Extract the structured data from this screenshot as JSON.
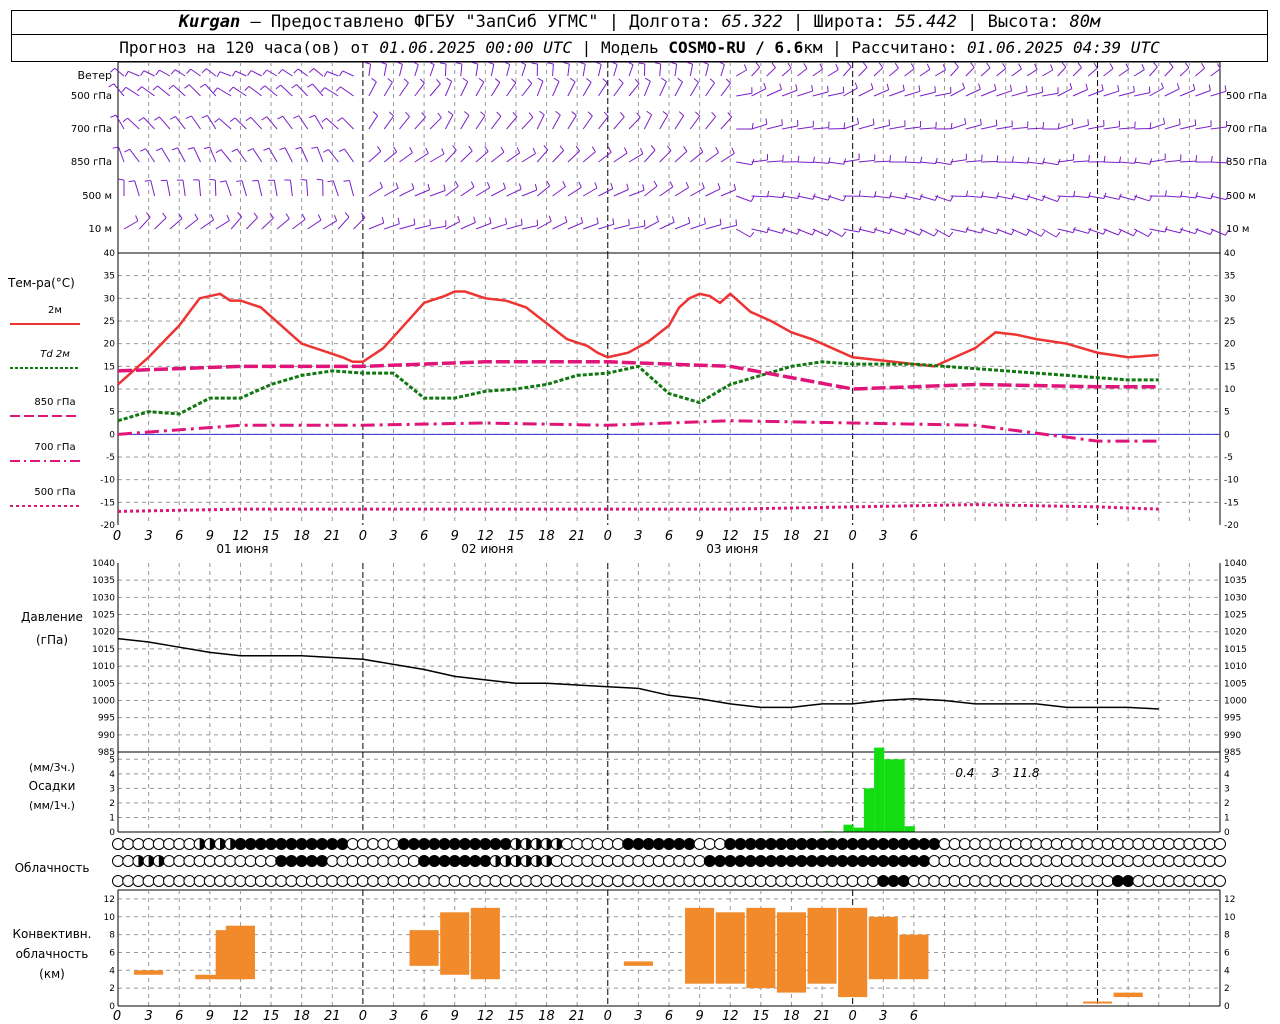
{
  "header": {
    "station": "Kurgan",
    "dash": " — ",
    "provider": "Предоставлено ФГБУ \"ЗапСиб УГМС\"",
    "lon_label": "Долгота:",
    "lon": "65.322",
    "lat_label": "Широта:",
    "lat": "55.442",
    "alt_label": "Высота:",
    "alt": "80м",
    "forecast_prefix": "Прогноз на 120 часа(ов) от",
    "forecast_time": "01.06.2025 00:00 UTC",
    "model_label": "Модель",
    "model": "COSMO-RU / 6.6",
    "model_unit": "км",
    "calc_label": "Рассчитано:",
    "calc_time": "01.06.2025 04:39 UTC",
    "sep": "|"
  },
  "wind": {
    "title": "Ветер",
    "levels": [
      "500 гПа",
      "700 гПа",
      "850 гПа",
      "500  м",
      "10   м"
    ]
  },
  "x_ticks": [
    "0",
    "3",
    "6",
    "9",
    "12",
    "15",
    "18",
    "21",
    "0",
    "3",
    "6",
    "9",
    "12",
    "15",
    "18",
    "21",
    "0",
    "3",
    "6",
    "9",
    "12",
    "15",
    "18",
    "21",
    "0",
    "3",
    "6"
  ],
  "day_labels": [
    "01 июня",
    "02 июня",
    "03 июня"
  ],
  "temperature": {
    "title": "Тем-ра(°C)",
    "legend": [
      {
        "label": "2м",
        "color": "#ee3333",
        "style": "solid"
      },
      {
        "label": "Td  2м",
        "color": "#117711",
        "style": "dotted"
      },
      {
        "label": "850 гПа",
        "color": "#e0157a",
        "style": "dash"
      },
      {
        "label": "700 гПа",
        "color": "#e0157a",
        "style": "dashdot"
      },
      {
        "label": "500 гПа",
        "color": "#e0157a",
        "style": "dot"
      }
    ],
    "y_ticks": [
      "40",
      "35",
      "30",
      "25",
      "20",
      "15",
      "10",
      "5",
      "0",
      "-5",
      "-10",
      "-15",
      "-20"
    ]
  },
  "pressure": {
    "title1": "Давление",
    "title2": "(гПа)",
    "y_ticks": [
      "1040",
      "1035",
      "1030",
      "1025",
      "1020",
      "1015",
      "1010",
      "1005",
      "1000",
      "995",
      "990",
      "985"
    ]
  },
  "precip": {
    "title1": "(мм/3ч.)",
    "title2": "Осадки",
    "title3": "(мм/1ч.)",
    "y_ticks": [
      "5",
      "4",
      "3",
      "2",
      "1",
      "0"
    ],
    "labels": [
      {
        "text": "0.4",
        "h": 83
      },
      {
        "text": "3",
        "h": 86
      },
      {
        "text": "11.8",
        "h": 89
      }
    ]
  },
  "clouds": {
    "title": "Облачность"
  },
  "convective": {
    "title1": "Конвективн.",
    "title2": "облачность",
    "title3": "(км)",
    "y_ticks": [
      "12",
      "10",
      "8",
      "6",
      "4",
      "2",
      "0"
    ]
  },
  "colors": {
    "temp2m": "#ee3333",
    "td": "#117711",
    "upper": "#e0157a",
    "wind": "#7a1fc9",
    "precip": "#11dd11",
    "conv": "#f08a2a",
    "grid": "#999999"
  },
  "chart_data": [
    {
      "type": "line",
      "title": "Тем-ра(°C)",
      "x_unit": "hours since 01.06.2025 00:00 UTC",
      "ylim": [
        -20,
        40
      ],
      "series": [
        {
          "name": "2м",
          "x": [
            0,
            3,
            6,
            8,
            10,
            11,
            12,
            14,
            16,
            18,
            20,
            22,
            23,
            24,
            26,
            28,
            30,
            32,
            33,
            34,
            36,
            38,
            40,
            42,
            44,
            46,
            47,
            48,
            50,
            52,
            54,
            55,
            56,
            57,
            58,
            59,
            60,
            62,
            64,
            66,
            68,
            70,
            72,
            74,
            76,
            78,
            80,
            82,
            84,
            86,
            88,
            90,
            93,
            96,
            99,
            102
          ],
          "y": [
            11,
            17,
            24,
            30,
            31,
            29.5,
            29.5,
            28,
            24,
            20,
            18.5,
            17,
            16,
            16,
            19,
            24,
            29,
            30.5,
            31.5,
            31.5,
            30,
            29.5,
            28,
            24.5,
            21,
            19.5,
            18,
            17,
            18,
            20.5,
            24,
            28,
            30,
            31,
            30.5,
            29,
            31,
            27,
            25,
            22.5,
            21,
            19,
            17,
            16.5,
            16,
            15.5,
            15,
            17,
            19,
            22.5,
            22,
            21,
            20,
            18,
            17,
            17.5
          ]
        },
        {
          "name": "Td  2м",
          "x": [
            0,
            3,
            6,
            9,
            12,
            15,
            18,
            21,
            24,
            27,
            30,
            33,
            36,
            39,
            42,
            45,
            48,
            51,
            54,
            57,
            60,
            63,
            66,
            69,
            72,
            75,
            78,
            81,
            84,
            87,
            90,
            93,
            96,
            99,
            102
          ],
          "y": [
            3,
            5,
            4.5,
            8,
            8,
            11,
            13,
            14,
            13.5,
            13.5,
            8,
            8,
            9.5,
            10,
            11,
            13,
            13.5,
            15,
            9,
            7,
            11,
            13,
            15,
            16,
            15.5,
            15.5,
            15.5,
            15,
            14.5,
            14,
            13.5,
            13,
            12.5,
            12,
            12
          ]
        },
        {
          "name": "850 гПа",
          "x": [
            0,
            12,
            24,
            36,
            48,
            60,
            72,
            84,
            96,
            102
          ],
          "y": [
            14,
            15,
            15,
            16,
            16,
            15,
            10,
            11,
            10.5,
            10.5
          ]
        },
        {
          "name": "700 гПа",
          "x": [
            0,
            12,
            24,
            36,
            48,
            60,
            72,
            84,
            96,
            102
          ],
          "y": [
            0,
            2,
            2,
            2.5,
            2,
            3,
            2.5,
            2,
            -1.5,
            -1.5
          ]
        },
        {
          "name": "500 гПа",
          "x": [
            0,
            12,
            24,
            36,
            48,
            60,
            72,
            84,
            96,
            102
          ],
          "y": [
            -17,
            -16.5,
            -16.5,
            -16.5,
            -16.5,
            -16.5,
            -16,
            -15.5,
            -16,
            -16.5
          ]
        }
      ]
    },
    {
      "type": "line",
      "title": "Давление",
      "x_unit": "hours since 01.06.2025 00:00 UTC",
      "ylim": [
        985,
        1040
      ],
      "series": [
        {
          "name": "",
          "x": [
            0,
            3,
            6,
            9,
            12,
            15,
            18,
            21,
            24,
            27,
            30,
            33,
            36,
            39,
            42,
            45,
            48,
            51,
            54,
            57,
            60,
            63,
            66,
            69,
            72,
            75,
            78,
            81,
            84,
            87,
            90,
            93,
            96,
            99,
            102
          ],
          "y": [
            1018,
            1017,
            1015.5,
            1014,
            1013,
            1013,
            1013,
            1012.5,
            1012,
            1010.5,
            1009,
            1007,
            1006,
            1005,
            1005,
            1004.5,
            1004,
            1003.5,
            1001.5,
            1000.5,
            999,
            998,
            998,
            999,
            999,
            1000,
            1000.5,
            1000,
            999,
            999,
            999,
            998,
            998,
            998,
            997.5
          ]
        }
      ]
    },
    {
      "type": "bar",
      "title": "Осадки",
      "x_unit": "hours since 01.06.2025 00:00 UTC",
      "ylim": [
        0,
        5.5
      ],
      "x": [
        69,
        71,
        72,
        73,
        74,
        75,
        76,
        77
      ],
      "values": [
        0.05,
        0.5,
        0.3,
        3,
        5.8,
        5,
        5,
        0.4
      ]
    },
    {
      "type": "bar",
      "title": "Конвективн. облачность (км)",
      "x_unit": "hours since 01.06.2025 00:00 UTC",
      "ylim": [
        0,
        13
      ],
      "bars": [
        {
          "x": 3,
          "bottom": 3.5,
          "top": 4
        },
        {
          "x": 9,
          "bottom": 3,
          "top": 3.5
        },
        {
          "x": 11,
          "bottom": 3,
          "top": 8.5
        },
        {
          "x": 12,
          "bottom": 3,
          "top": 9
        },
        {
          "x": 30,
          "bottom": 4.5,
          "top": 8.5
        },
        {
          "x": 33,
          "bottom": 3.5,
          "top": 10.5
        },
        {
          "x": 36,
          "bottom": 3,
          "top": 11
        },
        {
          "x": 51,
          "bottom": 4.5,
          "top": 5
        },
        {
          "x": 57,
          "bottom": 2.5,
          "top": 11
        },
        {
          "x": 60,
          "bottom": 2.5,
          "top": 10.5
        },
        {
          "x": 63,
          "bottom": 2,
          "top": 11
        },
        {
          "x": 66,
          "bottom": 1.5,
          "top": 10.5
        },
        {
          "x": 69,
          "bottom": 2.5,
          "top": 11
        },
        {
          "x": 72,
          "bottom": 1,
          "top": 11
        },
        {
          "x": 75,
          "bottom": 3,
          "top": 10
        },
        {
          "x": 78,
          "bottom": 3,
          "top": 8
        },
        {
          "x": 96,
          "bottom": 0.5,
          "top": 0.5
        },
        {
          "x": 99,
          "bottom": 1,
          "top": 1.5
        }
      ]
    }
  ]
}
